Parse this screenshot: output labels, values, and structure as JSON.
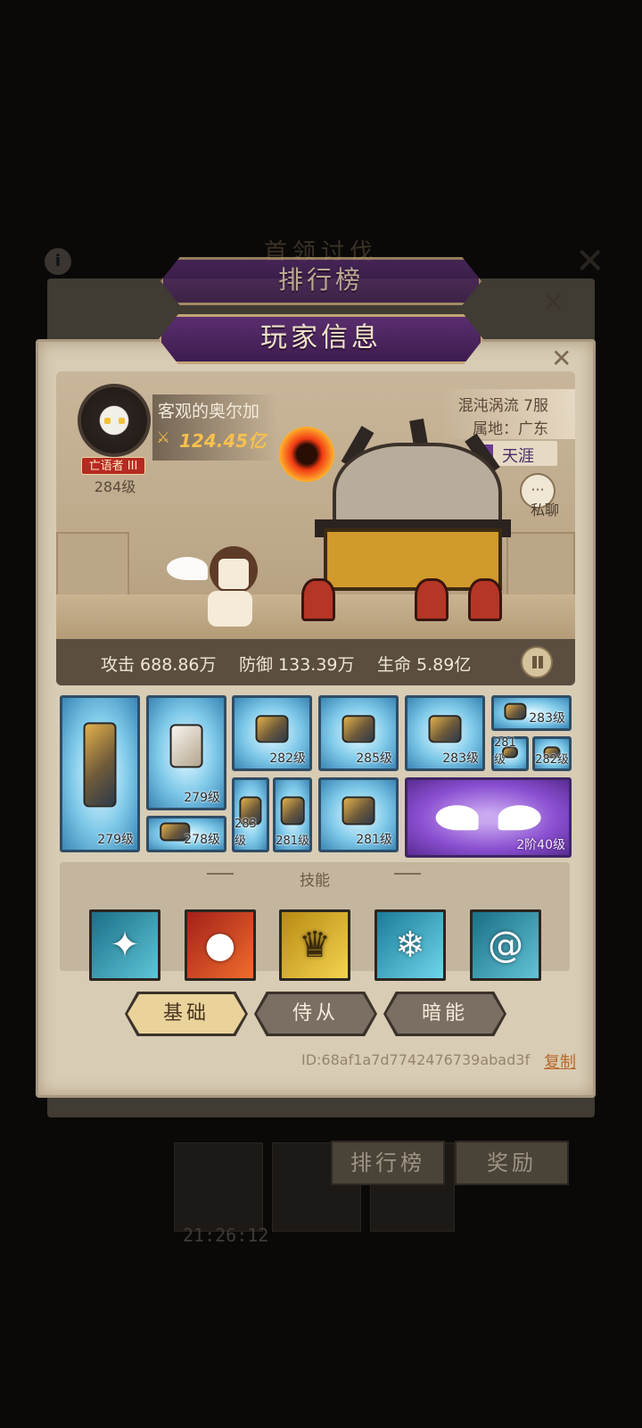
{
  "background": {
    "title": "首领讨伐",
    "info_icon": "i",
    "close_icon": "✕",
    "buttons": [
      "排行榜",
      "奖励"
    ],
    "timer": "21:26:12"
  },
  "tabs": {
    "ranking": "排行榜",
    "player_info": "玩家信息"
  },
  "player": {
    "name": "客观的奥尔加",
    "power": "124.45亿",
    "rank_title": "亡语者 III",
    "level": "284级",
    "server": "混沌涡流 7服",
    "region": "属地：广东",
    "guild": "天涯",
    "chat_label": "私聊",
    "stats": {
      "attack": "攻击 688.86万",
      "defense": "防御 133.39万",
      "hp": "生命 5.89亿"
    }
  },
  "equipment": [
    {
      "level": "279级"
    },
    {
      "level": "279级"
    },
    {
      "level": "278级"
    },
    {
      "level": "282级"
    },
    {
      "level": "283级"
    },
    {
      "level": "281级"
    },
    {
      "level": "285级"
    },
    {
      "level": "281级"
    },
    {
      "level": "283级"
    },
    {
      "level": "283级"
    },
    {
      "level": "281级"
    },
    {
      "level": "282级"
    },
    {
      "level": "2阶40级"
    }
  ],
  "skills": {
    "title": "技能",
    "icons": [
      "ice-spikes-icon",
      "fireball-icon",
      "golden-crown-icon",
      "snowflake-icon",
      "whirlwind-icon"
    ]
  },
  "bottom_tabs": {
    "basic": "基础",
    "follower": "侍从",
    "dark_energy": "暗能"
  },
  "player_id": "ID:68af1a7d7742476739abad3f",
  "copy_label": "复制",
  "colors": {
    "rare_blue": "#7dc8e8",
    "epic_purple": "#8a4fd1",
    "power_gold": "#f6c04f",
    "copy_link": "#b7692a"
  }
}
